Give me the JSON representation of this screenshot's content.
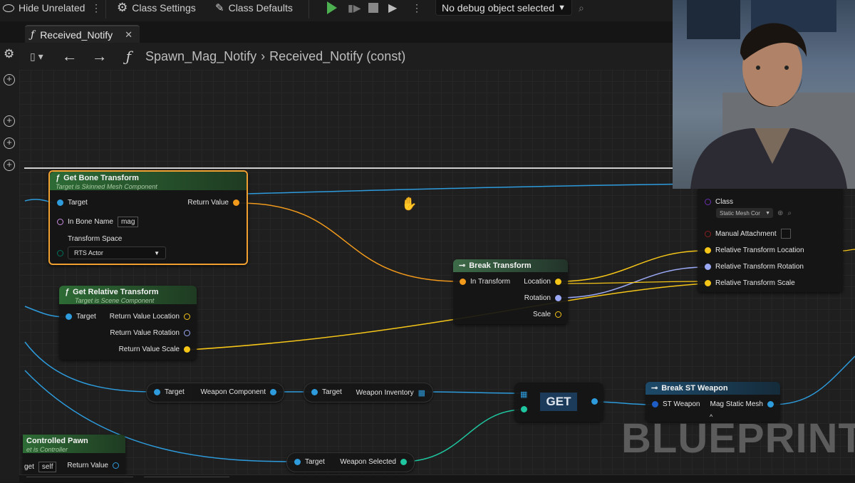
{
  "toolbar": {
    "hide_unrelated": "Hide Unrelated",
    "class_settings": "Class Settings",
    "class_defaults": "Class Defaults",
    "debug_object": "No debug object selected"
  },
  "tab": {
    "label": "Received_Notify",
    "close": "✕"
  },
  "breadcrumb": {
    "parent": "Spawn_Mag_Notify",
    "current": "Received_Notify (const)"
  },
  "nodes": {
    "get_bone_transform": {
      "title": "Get Bone Transform",
      "subtitle": "Target is Skinned Mesh Component",
      "pin_target": "Target",
      "pin_return": "Return Value",
      "pin_bone_name": "In Bone Name",
      "bone_name_value": "mag",
      "pin_transform_space": "Transform Space",
      "transform_space_value": "RTS Actor"
    },
    "get_relative_transform": {
      "title": "Get Relative Transform",
      "subtitle": "Target is Scene Component",
      "pin_target": "Target",
      "pin_location": "Return Value Location",
      "pin_rotation": "Return Value Rotation",
      "pin_scale": "Return Value Scale"
    },
    "break_transform": {
      "title": "Break Transform",
      "pin_in": "In Transform",
      "pin_location": "Location",
      "pin_rotation": "Rotation",
      "pin_scale": "Scale"
    },
    "spawn_node": {
      "pin_class": "Class",
      "class_value": "Static Mesh Cor",
      "pin_manual": "Manual Attachment",
      "pin_rel_location": "Relative Transform Location",
      "pin_rel_rotation": "Relative Transform Rotation",
      "pin_rel_scale": "Relative Transform Scale"
    },
    "weapon_component": {
      "pin_target": "Target",
      "pin_out": "Weapon Component"
    },
    "weapon_inventory": {
      "pin_target": "Target",
      "pin_out": "Weapon Inventory"
    },
    "get": {
      "label": "GET"
    },
    "break_st_weapon": {
      "title": "Break ST Weapon",
      "pin_in": "ST Weapon",
      "pin_out": "Mag Static Mesh"
    },
    "controlled_pawn": {
      "title": "Controlled Pawn",
      "subtitle": "et is Controller",
      "pin_target": "get",
      "self_value": "self",
      "pin_return": "Return Value"
    },
    "weapon_selected": {
      "pin_target": "Target",
      "pin_out": "Weapon Selected"
    }
  },
  "watermark": "BLUEPRINT",
  "colors": {
    "object_pin": "#2d9bdc",
    "struct_pin": "#f29a1b",
    "vector_pin": "#f5c518",
    "rotator_pin": "#9aa8f5",
    "name_pin": "#c98ee0",
    "byte_pin": "#00705a",
    "selection": "#f0a030",
    "function_header": "#2c5a30"
  }
}
